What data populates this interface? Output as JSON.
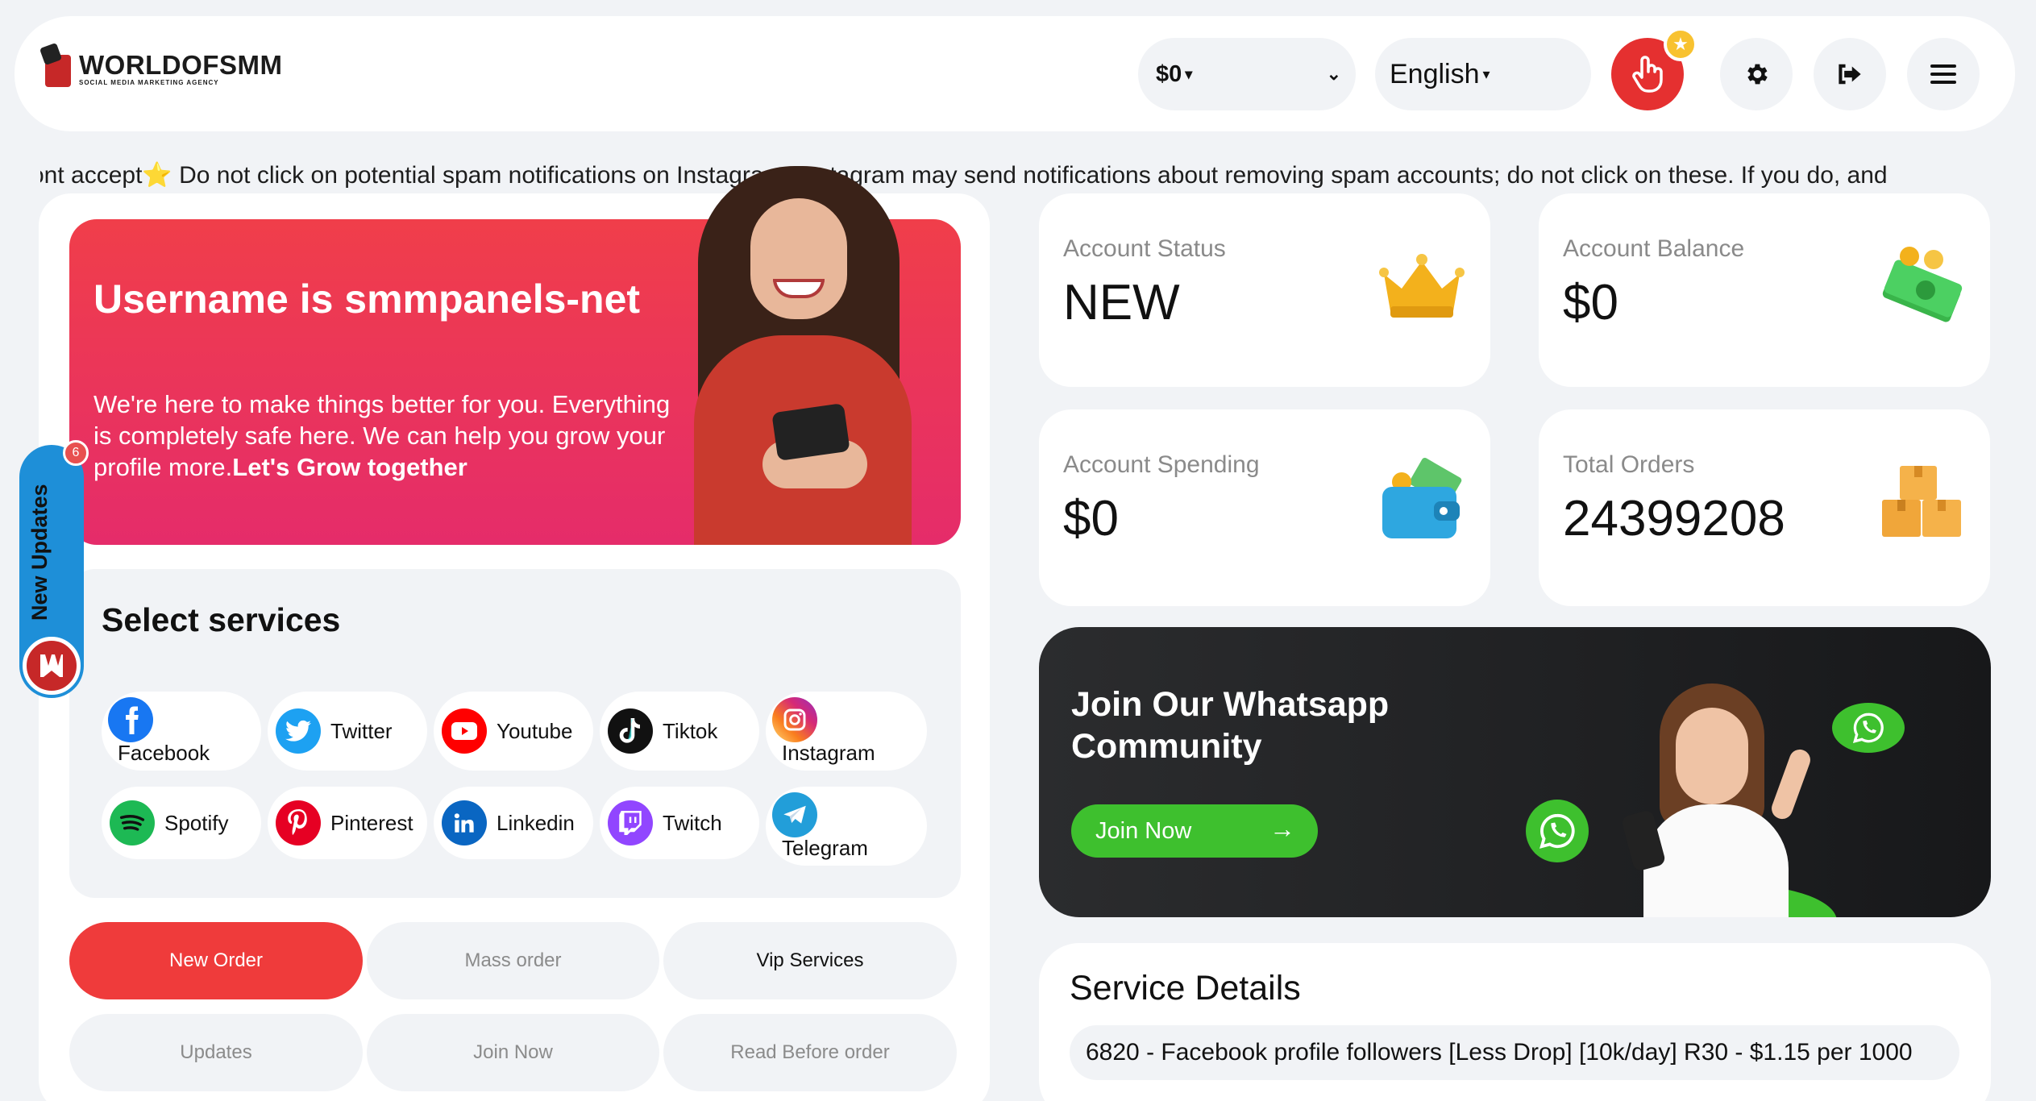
{
  "brand": {
    "name": "WORLDOFSMM",
    "tagline": "SOCIAL MEDIA MARKETING AGENCY",
    "accent_color": "#e53030"
  },
  "header": {
    "currency": "$0",
    "language": "English",
    "icons": [
      "tap-hand-icon",
      "star-icon",
      "gear-icon",
      "logout-icon",
      "menu-icon"
    ]
  },
  "marquee": {
    "text": "ont accept⭐ Do not click on potential spam notifications on Instagram. Instagram may send notifications about removing spam accounts; do not click on these. If you do, and"
  },
  "hero": {
    "title": "Username is smmpanels-net",
    "desc": "We're here to make things better for you. Everything is completely safe here. We can help you grow your profile more.",
    "desc_bold": "Let's Grow together"
  },
  "services": {
    "title": "Select services",
    "items": [
      {
        "label": "Facebook",
        "color": "#1877f2"
      },
      {
        "label": "Twitter",
        "color": "#1da1f2"
      },
      {
        "label": "Youtube",
        "color": "#ff0000"
      },
      {
        "label": "Tiktok",
        "color": "#111111"
      },
      {
        "label": "Instagram",
        "color": "#d6249f"
      },
      {
        "label": "Spotify",
        "color": "#1db954"
      },
      {
        "label": "Pinterest",
        "color": "#e60023"
      },
      {
        "label": "Linkedin",
        "color": "#0a66c2"
      },
      {
        "label": "Twitch",
        "color": "#9146ff"
      },
      {
        "label": "Telegram",
        "color": "#229ed9"
      }
    ]
  },
  "tabs": [
    {
      "label": "New Order"
    },
    {
      "label": "Mass order"
    },
    {
      "label": "Vip Services"
    },
    {
      "label": "Updates"
    },
    {
      "label": "Join Now"
    },
    {
      "label": "Read Before order"
    }
  ],
  "updates_widget": {
    "label": "New Updates",
    "count": "6"
  },
  "stats": [
    {
      "label": "Account Status",
      "value": "NEW",
      "icon": "crown-icon"
    },
    {
      "label": "Account Balance",
      "value": "$0",
      "icon": "money-icon"
    },
    {
      "label": "Account Spending",
      "value": "$0",
      "icon": "wallet-icon"
    },
    {
      "label": "Total Orders",
      "value": "24399208",
      "icon": "boxes-icon"
    }
  ],
  "whatsapp": {
    "title": "Join Our Whatsapp Community",
    "button": "Join Now",
    "brand_color": "#3ec02e"
  },
  "service_details": {
    "title": "Service Details",
    "selected": "6820 - Facebook profile followers [Less Drop] [10k/day] R30 - $1.15 per 1000"
  }
}
